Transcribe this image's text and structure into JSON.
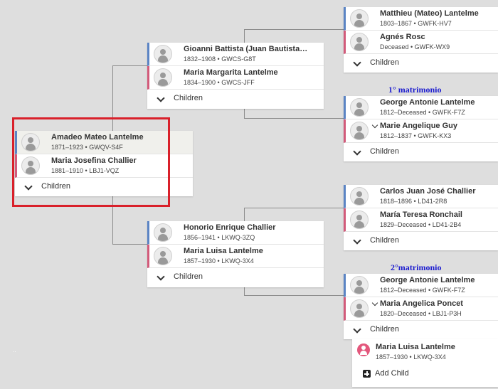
{
  "root": {
    "father": {
      "name": "Amadeo Mateo Lantelme",
      "meta": "1871–1923 • GWQV-S4F"
    },
    "mother": {
      "name": "Maria Josefina Challier",
      "meta": "1881–1910 • LBJ1-VQZ"
    },
    "children_label": "Children"
  },
  "paternal": {
    "father": {
      "name": "Gioanni Battista (Juan Bautista…",
      "meta": "1832–1908 • GWCS-G8T"
    },
    "mother": {
      "name": "Maria Margarita Lantelme",
      "meta": "1834–1900 • GWCS-JFF"
    },
    "children_label": "Children"
  },
  "maternal": {
    "father": {
      "name": "Honorio Enrique Challier",
      "meta": "1856–1941 • LKWQ-3ZQ"
    },
    "mother": {
      "name": "Maria Luisa Lantelme",
      "meta": "1857–1930 • LKWQ-3X4"
    },
    "children_label": "Children"
  },
  "gen3": [
    {
      "father": {
        "name": "Matthieu (Mateo) Lantelme",
        "meta": "1803–1867 • GWFK-HV7"
      },
      "mother": {
        "name": "Agnés Rosc",
        "meta": "Deceased • GWFK-WX9"
      },
      "children_label": "Children"
    },
    {
      "marriage_label": "1° matrimonio",
      "father": {
        "name": "George Antonie Lantelme",
        "meta": "1812–Deceased • GWFK-F7Z"
      },
      "mother": {
        "name": "Marie Angelique Guy",
        "meta": "1812–1837 • GWFK-KX3"
      },
      "children_label": "Children"
    },
    {
      "father": {
        "name": "Carlos Juan José Challier",
        "meta": "1818–1896 • LD41-2R8"
      },
      "mother": {
        "name": "María Teresa Ronchail",
        "meta": "1829–Deceased • LD41-2B4"
      },
      "children_label": "Children"
    },
    {
      "marriage_label": "2°matrimonio",
      "father": {
        "name": "George Antonie Lantelme",
        "meta": "1812–Deceased • GWFK-F7Z"
      },
      "mother": {
        "name": "Maria Angelica Poncet",
        "meta": "1820–Deceased • LBJ1-P3H"
      },
      "children_label": "Children"
    }
  ],
  "child_popup": {
    "name": "Maria Luisa Lantelme",
    "meta": "1857–1930 • LKWQ-3X4",
    "add_child_label": "Add Child"
  },
  "stray_mark": "..",
  "colors": {
    "background": "#dedede",
    "father_bar": "#5b84c4",
    "mother_bar": "#d25a7a",
    "highlight": "#d9202a",
    "marriage_text": "#1c1ccf"
  }
}
